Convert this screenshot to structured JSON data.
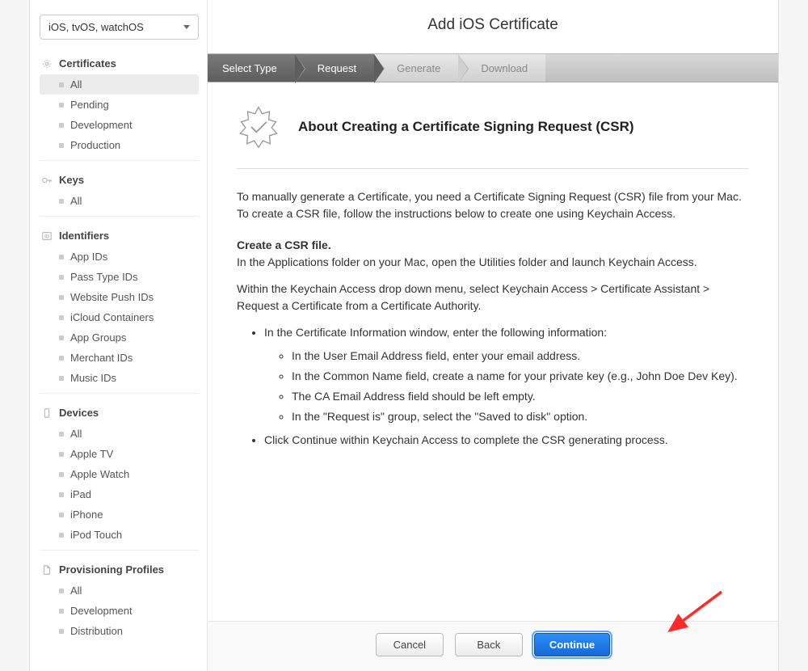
{
  "platform_selector": {
    "selected": "iOS, tvOS, watchOS"
  },
  "sidebar": {
    "sections": [
      {
        "name": "certificates",
        "label": "Certificates",
        "icon": "gear-icon",
        "items": [
          {
            "label": "All",
            "active": true
          },
          {
            "label": "Pending"
          },
          {
            "label": "Development"
          },
          {
            "label": "Production"
          }
        ]
      },
      {
        "name": "keys",
        "label": "Keys",
        "icon": "key-icon",
        "items": [
          {
            "label": "All"
          }
        ]
      },
      {
        "name": "identifiers",
        "label": "Identifiers",
        "icon": "id-icon",
        "items": [
          {
            "label": "App IDs"
          },
          {
            "label": "Pass Type IDs"
          },
          {
            "label": "Website Push IDs"
          },
          {
            "label": "iCloud Containers"
          },
          {
            "label": "App Groups"
          },
          {
            "label": "Merchant IDs"
          },
          {
            "label": "Music IDs"
          }
        ]
      },
      {
        "name": "devices",
        "label": "Devices",
        "icon": "device-icon",
        "items": [
          {
            "label": "All"
          },
          {
            "label": "Apple TV"
          },
          {
            "label": "Apple Watch"
          },
          {
            "label": "iPad"
          },
          {
            "label": "iPhone"
          },
          {
            "label": "iPod Touch"
          }
        ]
      },
      {
        "name": "provisioning",
        "label": "Provisioning Profiles",
        "icon": "file-icon",
        "items": [
          {
            "label": "All"
          },
          {
            "label": "Development"
          },
          {
            "label": "Distribution"
          }
        ]
      }
    ]
  },
  "main": {
    "title": "Add iOS Certificate",
    "steps": [
      {
        "label": "Select Type",
        "active": true
      },
      {
        "label": "Request",
        "active": true
      },
      {
        "label": "Generate",
        "active": false
      },
      {
        "label": "Download",
        "active": false
      }
    ],
    "content": {
      "heading": "About Creating a Certificate Signing Request (CSR)",
      "intro": "To manually generate a Certificate, you need a Certificate Signing Request (CSR) file from your Mac. To create a CSR file, follow the instructions below to create one using Keychain Access.",
      "subhead": "Create a CSR file.",
      "sub_intro": "In the Applications folder on your Mac, open the Utilities folder and launch Keychain Access.",
      "menu_path": "Within the Keychain Access drop down menu, select Keychain Access > Certificate Assistant > Request a Certificate from a Certificate Authority.",
      "bullets_outer": [
        "In the Certificate Information window, enter the following information:",
        "Click Continue within Keychain Access to complete the CSR generating process."
      ],
      "bullets_inner": [
        "In the User Email Address field, enter your email address.",
        "In the Common Name field, create a name for your private key (e.g., John Doe Dev Key).",
        "The CA Email Address field should be left empty.",
        "In the \"Request is\" group, select the \"Saved to disk\" option."
      ]
    },
    "footer": {
      "cancel": "Cancel",
      "back": "Back",
      "continue": "Continue"
    }
  }
}
